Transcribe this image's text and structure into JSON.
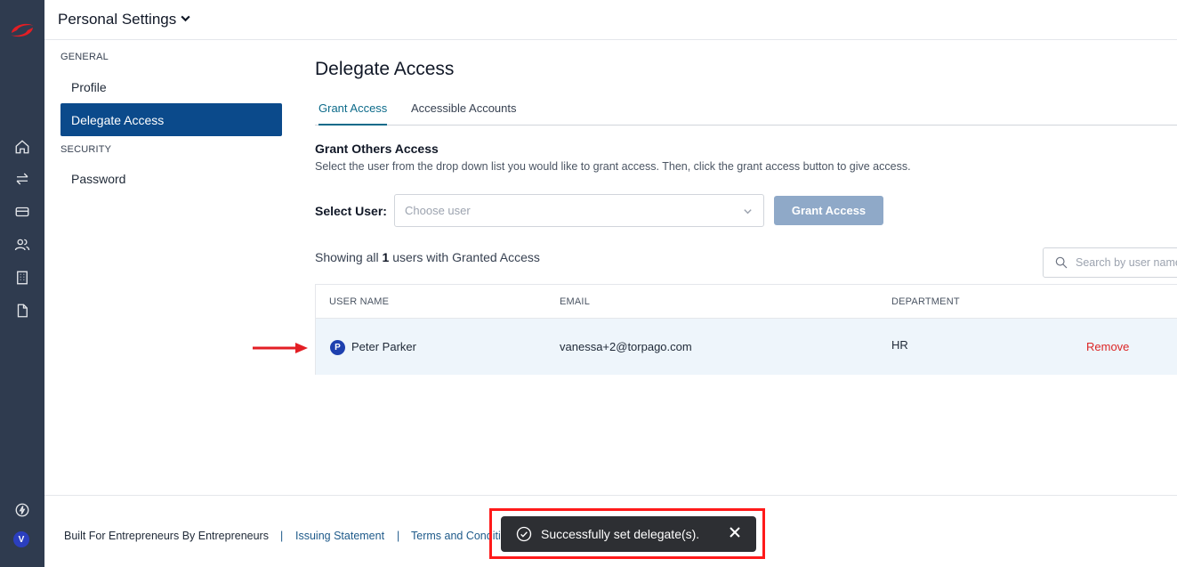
{
  "header": {
    "title": "Personal Settings"
  },
  "settings_nav": {
    "general_heading": "GENERAL",
    "items": [
      {
        "label": "Profile"
      },
      {
        "label": "Delegate Access",
        "active": true
      }
    ],
    "security_heading": "SECURITY",
    "security_items": [
      {
        "label": "Password"
      }
    ]
  },
  "main": {
    "title": "Delegate Access",
    "tabs": [
      {
        "label": "Grant Access",
        "active": true
      },
      {
        "label": "Accessible Accounts"
      }
    ],
    "grant": {
      "title": "Grant Others Access",
      "description": "Select the user from the drop down list you would like to grant access. Then, click the grant access button to give access.",
      "select_label": "Select User:",
      "select_placeholder": "Choose user",
      "button_label": "Grant Access"
    },
    "showing": {
      "prefix": "Showing all",
      "count": "1",
      "suffix": "users with Granted Access"
    },
    "search_placeholder": "Search by user name",
    "table": {
      "columns": [
        "USER NAME",
        "EMAIL",
        "DEPARTMENT"
      ],
      "rows": [
        {
          "avatar_initial": "P",
          "name": "Peter Parker",
          "email": "vanessa+2@torpago.com",
          "department": "HR",
          "action": "Remove"
        }
      ]
    }
  },
  "footer": {
    "tagline": "Built For Entrepreneurs By Entrepreneurs",
    "separator": "|",
    "links": [
      "Issuing Statement",
      "Terms and Conditi"
    ]
  },
  "toast": {
    "message": "Successfully set delegate(s)."
  },
  "rail": {
    "user_initial": "V"
  },
  "colors": {
    "rail_bg": "#2f3b4f",
    "active_nav": "#0b4a8b",
    "accent_tab": "#0d6b8a",
    "remove": "#dc2626",
    "toast_bg": "#2d2f33",
    "highlight": "#ff1a1a"
  }
}
